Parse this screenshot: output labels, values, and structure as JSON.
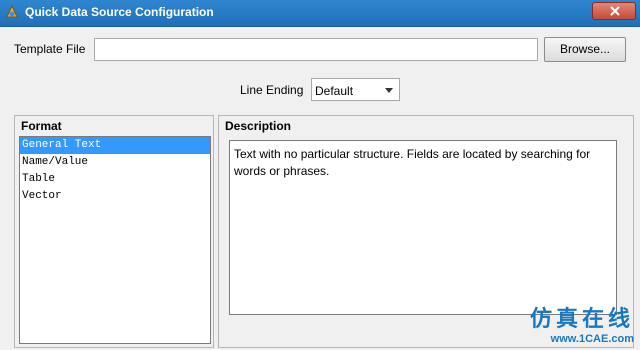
{
  "window": {
    "title": "Quick Data Source Configuration",
    "icon": "app-icon"
  },
  "template_file": {
    "label": "Template File",
    "value": "",
    "browse_label": "Browse..."
  },
  "line_ending": {
    "label": "Line Ending",
    "selected": "Default"
  },
  "format": {
    "title": "Format",
    "items": [
      "General Text",
      "Name/Value",
      "Table",
      "Vector"
    ],
    "selected_index": 0
  },
  "description": {
    "title": "Description",
    "text": "Text with no particular structure. Fields are located by searching for words or phrases."
  },
  "watermark": {
    "chinese": "仿真在线",
    "url": "www.1CAE.com"
  },
  "colors": {
    "titlebar": "#2f86cf",
    "selection": "#3399ff",
    "close": "#c74a36"
  }
}
